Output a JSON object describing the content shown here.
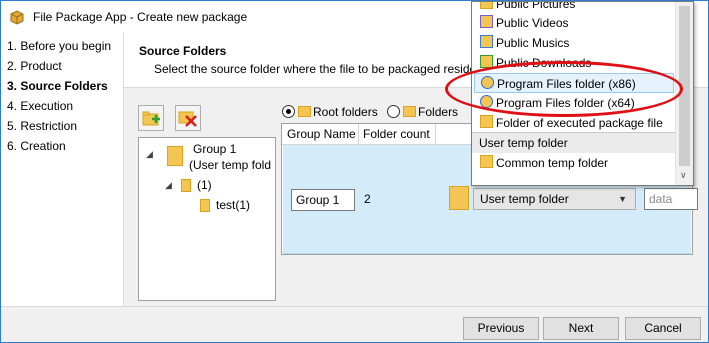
{
  "window": {
    "title": "File Package App - Create new package",
    "icon": "box-icon"
  },
  "steps": [
    {
      "label": "1. Before you begin",
      "active": false
    },
    {
      "label": "2. Product",
      "active": false
    },
    {
      "label": "3. Source Folders",
      "active": true
    },
    {
      "label": "4. Execution",
      "active": false
    },
    {
      "label": "5. Restriction",
      "active": false
    },
    {
      "label": "6. Creation",
      "active": false
    }
  ],
  "header": {
    "title": "Source Folders",
    "description": "Select the source folder where the file to be packaged reside"
  },
  "toolbar": {
    "add_icon": "add-folder-icon",
    "delete_icon": "delete-icon"
  },
  "tree": {
    "group_line1": "Group 1",
    "group_line2": "(User temp fold",
    "child": "(1)",
    "grandchild": "test(1)"
  },
  "view_options": {
    "root_folders": "Root folders",
    "folders": "Folders",
    "selected": "root_folders"
  },
  "grid": {
    "columns": [
      "Group Name",
      "Folder count"
    ],
    "row": {
      "group_name": "Group 1",
      "folder_count": "2",
      "location": "User temp folder",
      "data": "data"
    }
  },
  "dropdown": {
    "items": [
      {
        "label": "Public Pictures",
        "icon": "pictures-folder-icon"
      },
      {
        "label": "Public Videos",
        "icon": "videos-folder-icon"
      },
      {
        "label": "Public Musics",
        "icon": "music-folder-icon"
      },
      {
        "label": "Public Downloads",
        "icon": "downloads-folder-icon"
      },
      {
        "label": "Program Files folder (x86)",
        "icon": "program-files-icon",
        "highlighted": true
      },
      {
        "label": "Program Files folder (x64)",
        "icon": "program-files-icon"
      },
      {
        "label": "Folder of executed package file",
        "icon": "folder-icon"
      }
    ],
    "group_header": "User temp folder",
    "group_items": [
      {
        "label": "Common temp folder",
        "icon": "folder-icon"
      }
    ]
  },
  "buttons": {
    "previous": "Previous",
    "next": "Next",
    "cancel": "Cancel"
  },
  "colors": {
    "accent": "#2b7cd3",
    "selection": "#d4ecf9",
    "annotation": "#e00f16"
  }
}
